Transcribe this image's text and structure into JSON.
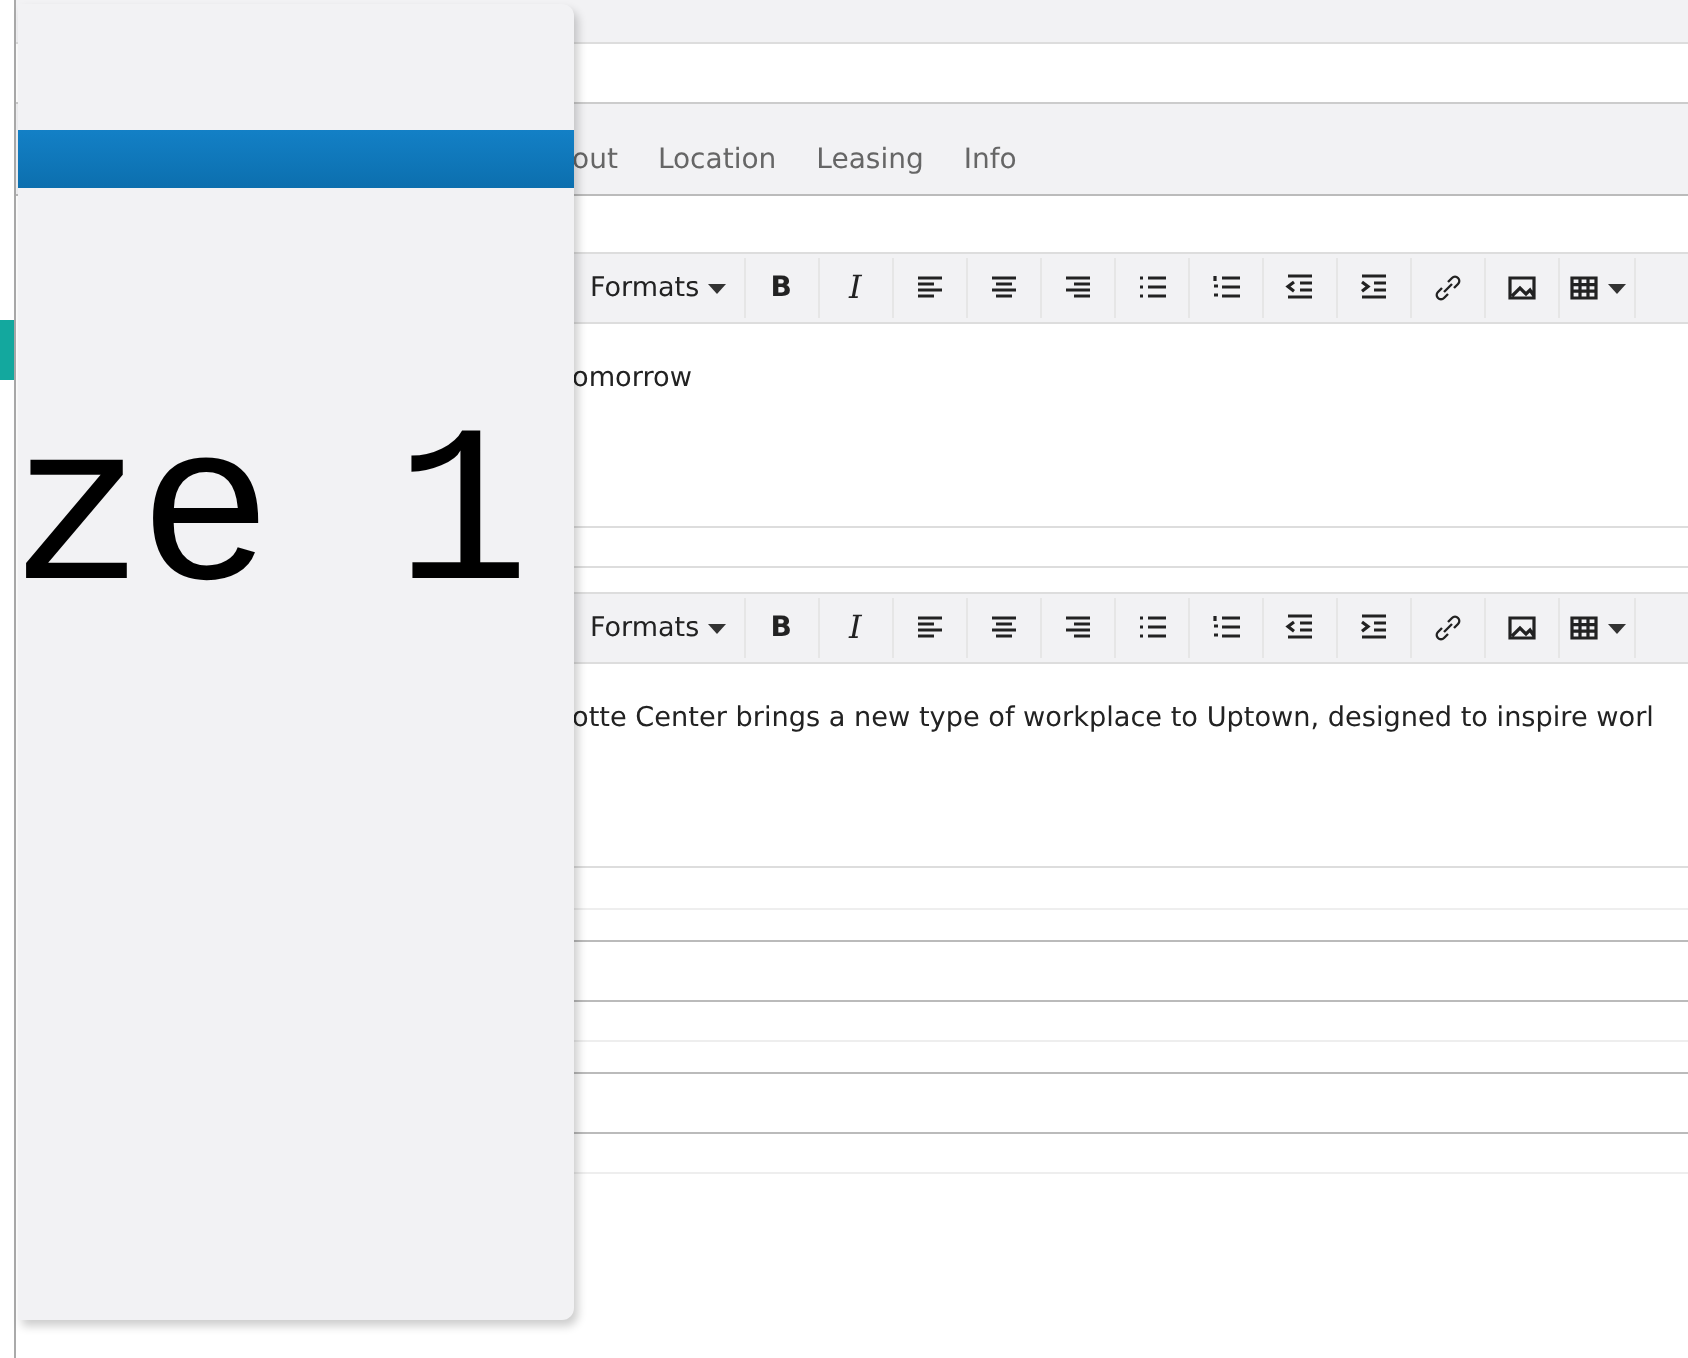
{
  "tabs": [
    {
      "label": "out",
      "selected": false
    },
    {
      "label": "Location",
      "selected": false
    },
    {
      "label": "Leasing",
      "selected": false
    },
    {
      "label": "Info",
      "selected": false
    }
  ],
  "editors": [
    {
      "toolbar": [
        {
          "kind": "formats",
          "label": "Formats"
        },
        {
          "kind": "bold",
          "label": "B"
        },
        {
          "kind": "italic",
          "label": "I"
        },
        {
          "kind": "align-left"
        },
        {
          "kind": "align-center"
        },
        {
          "kind": "align-right"
        },
        {
          "kind": "bullet-list"
        },
        {
          "kind": "numbered-list"
        },
        {
          "kind": "outdent"
        },
        {
          "kind": "indent"
        },
        {
          "kind": "link"
        },
        {
          "kind": "image"
        },
        {
          "kind": "table"
        }
      ],
      "content": "omorrow"
    },
    {
      "toolbar": [
        {
          "kind": "formats",
          "label": "Formats"
        },
        {
          "kind": "bold",
          "label": "B"
        },
        {
          "kind": "italic",
          "label": "I"
        },
        {
          "kind": "align-left"
        },
        {
          "kind": "align-center"
        },
        {
          "kind": "align-right"
        },
        {
          "kind": "bullet-list"
        },
        {
          "kind": "numbered-list"
        },
        {
          "kind": "outdent"
        },
        {
          "kind": "indent"
        },
        {
          "kind": "link"
        },
        {
          "kind": "image"
        },
        {
          "kind": "table"
        }
      ],
      "content": "otte Center brings a new type of workplace to Uptown, designed to inspire worl"
    }
  ],
  "overlay": {
    "big_text": "ze 1"
  }
}
